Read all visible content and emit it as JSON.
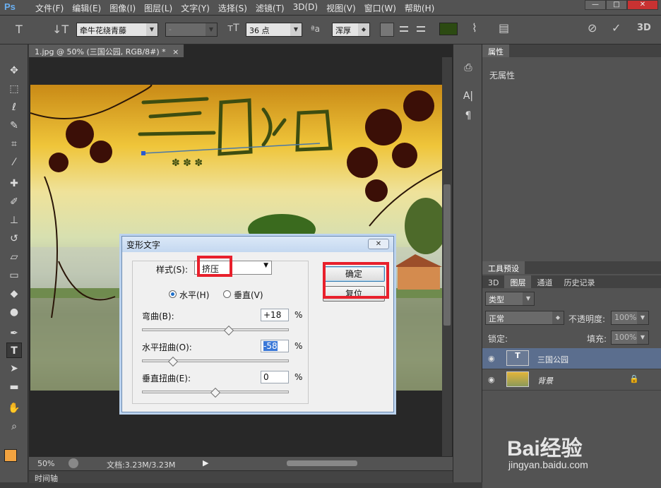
{
  "app": {
    "logo": "Ps"
  },
  "menu": [
    "文件(F)",
    "编辑(E)",
    "图像(I)",
    "图层(L)",
    "文字(Y)",
    "选择(S)",
    "滤镜(T)",
    "3D(D)",
    "视图(V)",
    "窗口(W)",
    "帮助(H)"
  ],
  "options": {
    "font_family": "牵牛花绕青藤",
    "font_style": "-",
    "font_size": "36 点",
    "aa_label": "ªa",
    "aa_value": "浑厚",
    "color": "#2c4a12",
    "mode_3d": "3D"
  },
  "doc": {
    "tab": "1.jpg @ 50% (三国公园, RGB/8#) *",
    "close": "×"
  },
  "canvas_text": "三国公园",
  "status": {
    "zoom": "50%",
    "info": "文档:3.23M/3.23M"
  },
  "timeline": {
    "label": "时间轴"
  },
  "properties": {
    "tab": "属性",
    "text": "无属性"
  },
  "tool_presets": {
    "tab": "工具预设"
  },
  "layers_panel": {
    "tabs": [
      "3D",
      "图层",
      "通道",
      "历史记录"
    ],
    "filter": "类型",
    "blend": "正常",
    "opacity_label": "不透明度:",
    "opacity": "100%",
    "lock_label": "锁定:",
    "fill_label": "填充:",
    "fill": "100%"
  },
  "layers": [
    {
      "name": "三国公园",
      "type": "T"
    },
    {
      "name": "背景"
    }
  ],
  "dialog": {
    "title": "变形文字",
    "style_label": "样式(S):",
    "style_value": "挤压",
    "horizontal": "水平(H)",
    "vertical": "垂直(V)",
    "bend_label": "弯曲(B):",
    "bend": "+18",
    "hdist_label": "水平扭曲(O):",
    "hdist": "-58",
    "vdist_label": "垂直扭曲(E):",
    "vdist": "0",
    "unit": "%",
    "ok": "确定",
    "reset": "复位",
    "bend_level": 0.59,
    "hdist_level": 0.21,
    "vdist_level": 0.5
  },
  "watermark": {
    "brand": "Bai经验",
    "url": "jingyan.baidu.com"
  },
  "colors": {
    "dialog_highlight": "#e8202c",
    "panel": "#535353",
    "accent": "#6ab0f3"
  }
}
